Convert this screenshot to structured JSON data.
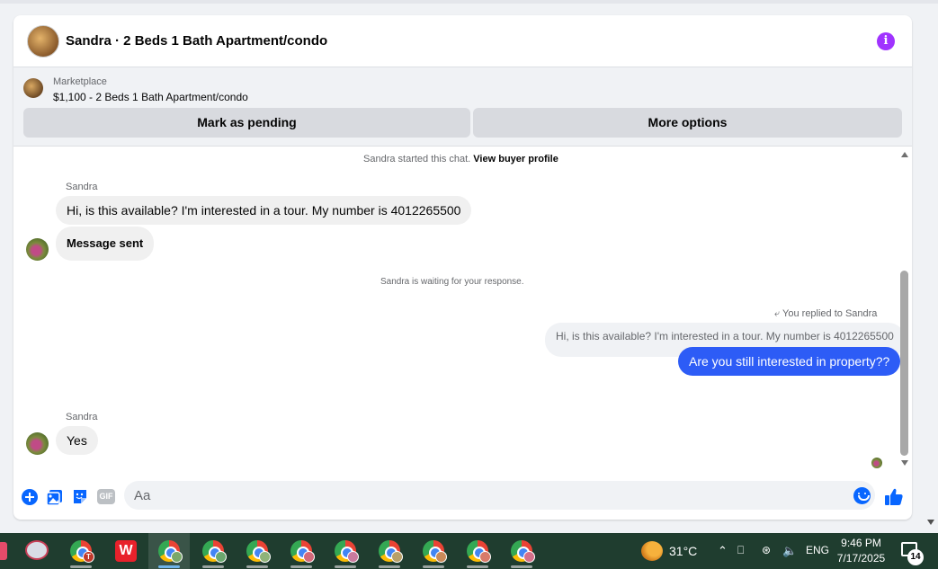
{
  "header": {
    "title": "Sandra · 2 Beds 1 Bath Apartment/condo"
  },
  "marketplace": {
    "label": "Marketplace",
    "listing": "$1,100 - 2 Beds 1 Bath Apartment/condo",
    "mark_pending_label": "Mark as pending",
    "more_options_label": "More options"
  },
  "conversation": {
    "started_text": "Sandra started this chat.",
    "view_profile_link": "View buyer profile",
    "sender_name": "Sandra",
    "msg1": "Hi, is this available? I'm interested in a tour. My number is 4012265500",
    "msg2": "Message sent",
    "waiting_text": "Sandra is waiting for your response.",
    "replied_text": "You replied to Sandra",
    "quoted_text": "Hi, is this available? I'm interested in a tour. My number is 4012265500",
    "reply_text": "Are you still interested in property??",
    "sender_name2": "Sandra",
    "msg3": "Yes"
  },
  "composer": {
    "placeholder": "Aa",
    "gif_label": "GIF"
  },
  "taskbar": {
    "temperature": "31°C",
    "language": "ENG",
    "time": "9:46 PM",
    "date": "7/17/2025",
    "notification_count": "14",
    "wps_label": "W",
    "badge_t": "T"
  },
  "colors": {
    "accent": "#0866ff",
    "outgoing_bubble": "#2d5cf6",
    "info_icon": "#a033ff",
    "taskbar": "#1f3d2f"
  }
}
